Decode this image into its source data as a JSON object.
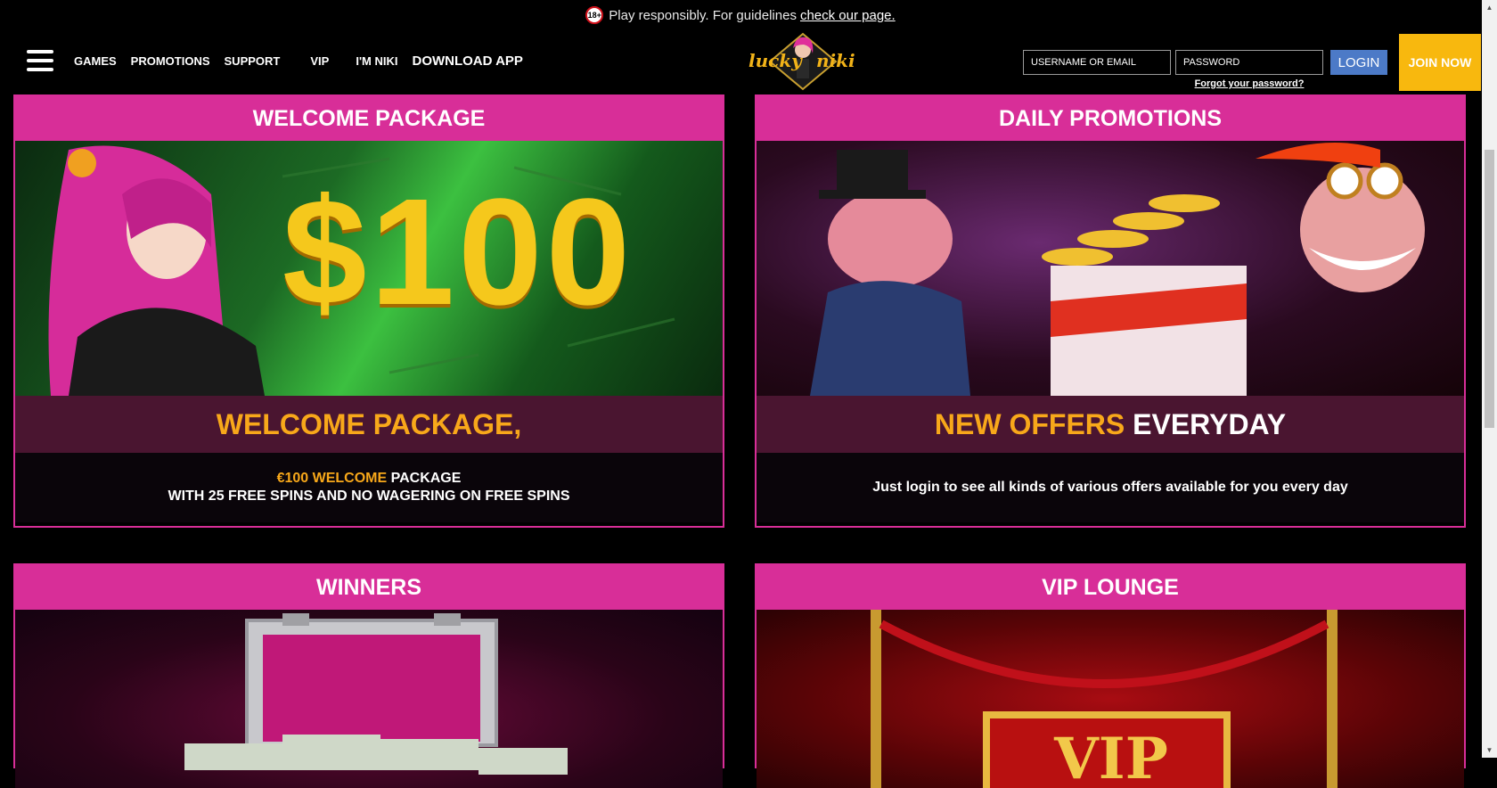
{
  "notice": {
    "badge": "18+",
    "text": "Play responsibly. For guidelines",
    "link": "check our page."
  },
  "nav": {
    "items": [
      "GAMES",
      "PROMOTIONS",
      "SUPPORT",
      "VIP",
      "I'M NIKI",
      "DOWNLOAD APP"
    ]
  },
  "logo": {
    "text_left": "lucky",
    "text_right": "niki"
  },
  "login": {
    "username_placeholder": "USERNAME OR EMAIL",
    "password_placeholder": "PASSWORD",
    "login_label": "LOGIN",
    "forgot_label": "Forgot your password?",
    "join_label": "JOIN NOW"
  },
  "cards": [
    {
      "title": "WELCOME PACKAGE",
      "banner_text": "$100",
      "sub": "WELCOME PACKAGE,",
      "desc_highlight": "€100 WELCOME",
      "desc_rest": " PACKAGE",
      "desc_line2": "WITH 25 FREE SPINS AND NO WAGERING ON FREE SPINS"
    },
    {
      "title": "DAILY PROMOTIONS",
      "sub_highlight": "NEW OFFERS",
      "sub_rest": " EVERYDAY",
      "desc": "Just login to see all kinds of various offers available for you every day"
    },
    {
      "title": "WINNERS"
    },
    {
      "title": "VIP LOUNGE",
      "banner_text": "VIP"
    }
  ],
  "colors": {
    "accent": "#d82e98",
    "highlight": "#f8a81a",
    "login_button": "#4c7ac7",
    "join_button": "#f8b80e"
  }
}
